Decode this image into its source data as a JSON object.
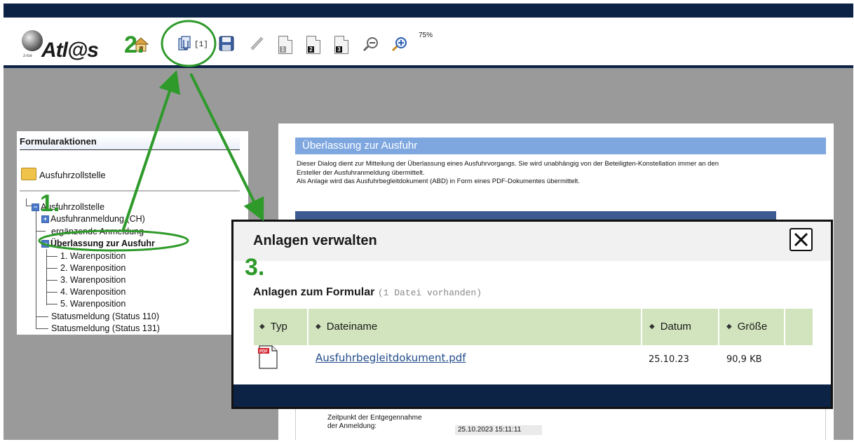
{
  "toolbar": {
    "logo_text": "Atl@s",
    "logo_sub": "z-ice",
    "attach_count": "[1]",
    "zoom_level": "75%",
    "page_buttons": [
      "1",
      "2",
      "3"
    ]
  },
  "steps": {
    "step1": "1.",
    "step2": "2.",
    "step3": "3."
  },
  "left_panel": {
    "title": "Formularaktionen",
    "folder_label": "Ausfuhrzollstelle",
    "tree": {
      "root": "Ausfuhrzollstelle",
      "item1": "Ausfuhranmeldung (CH)",
      "item2": "ergänzende Anmeldung",
      "item3": "Überlassung zur Ausfuhr",
      "sub1": "1. Warenposition",
      "sub2": "2. Warenposition",
      "sub3": "3. Warenposition",
      "sub4": "4. Warenposition",
      "sub5": "5. Warenposition",
      "status1": "Statusmeldung (Status 110)",
      "status2": "Statusmeldung (Status 131)"
    }
  },
  "form": {
    "header": "Überlassung zur  Ausfuhr",
    "desc_line1": "Dieser Dialog dient zur Mitteilung der Überlassung eines Ausfuhrvorgangs. Sie wird unabhängig von der Beteiligten-Konstellation immer an den",
    "desc_line2": "Ersteller der Ausfuhranmeldung übermittelt.",
    "desc_line3": "Als Anlage wird das Ausfuhrbegleitdokument (ABD) in Form eines PDF-Dokumentes übermittelt.",
    "field_label_1": "Zeitpunkt der Entgegennahme",
    "field_label_2": "der Anmeldung:",
    "field_value": "25.10.2023 15:11:11"
  },
  "dialog": {
    "title": "Anlagen verwalten",
    "subtitle": "Anlagen zum Formular",
    "file_count": "(1 Datei vorhanden)",
    "columns": {
      "typ": "Typ",
      "dateiname": "Dateiname",
      "datum": "Datum",
      "groesse": "Größe"
    },
    "row": {
      "type_icon": "pdf-icon",
      "type_badge": "PDF",
      "filename": "Ausfuhrbegleitdokument.pdf",
      "date": "25.10.23",
      "size": "90,9 KB"
    }
  },
  "colors": {
    "navy": "#0d2346",
    "green_annotation": "#2e9a2a",
    "table_header": "#d1e4bd",
    "form_header": "#7ea7e0",
    "link": "#234d8a"
  }
}
